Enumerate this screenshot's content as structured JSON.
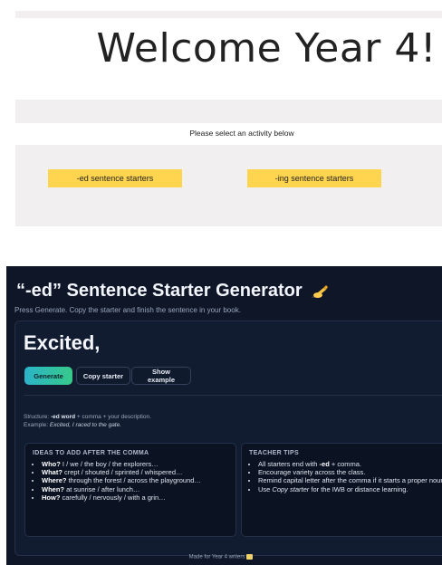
{
  "welcome": {
    "heading": "Welcome Year 4!",
    "prompt": "Please select an activity below",
    "activities": [
      {
        "label": "-ed sentence starters"
      },
      {
        "label": "-ing sentence starters"
      }
    ]
  },
  "generator": {
    "title": "“-ed” Sentence Starter Generator",
    "title_icon": "writing-hand-icon",
    "subtitle": "Press Generate. Copy the starter and finish the sentence in your book.",
    "starter": "Excited,",
    "buttons": {
      "generate": "Generate",
      "copy": "Copy starter",
      "example": "Show example"
    },
    "structure": {
      "label": "Structure: ",
      "bold": "-ed word",
      "rest": " + comma + your description.",
      "example_label": "Example: ",
      "example_text": "Excited, I raced to the gate."
    },
    "ideas": {
      "heading": "Ideas to add after the comma",
      "items": [
        {
          "key": "Who?",
          "text": " I / we / the boy / the explorers…"
        },
        {
          "key": "What?",
          "text": " crept / shouted / sprinted / whispered…"
        },
        {
          "key": "Where?",
          "text": " through the forest / across the playground…"
        },
        {
          "key": "When?",
          "text": " at sunrise / after lunch…"
        },
        {
          "key": "How?",
          "text": " carefully / nervously / with a grin…"
        }
      ]
    },
    "tips": {
      "heading": "Teacher tips",
      "items": [
        {
          "pre": "All starters end with ",
          "bold": "-ed",
          "post": " + comma."
        },
        {
          "pre": "Encourage variety across the class.",
          "bold": "",
          "post": ""
        },
        {
          "pre": "Remind capital letter after the comma if it starts a proper noun.",
          "bold": "",
          "post": ""
        },
        {
          "pre": "Use ",
          "italic": "Copy starter",
          "post": " for the IWB or distance learning."
        }
      ]
    },
    "footer": "Made for Year 4 writers",
    "footer_icon": "memo-icon",
    "colors": {
      "background": "#0e1628",
      "accent_start": "#2bb4c9",
      "accent_end": "#37c98a",
      "activity_button": "#ffd54f"
    }
  }
}
